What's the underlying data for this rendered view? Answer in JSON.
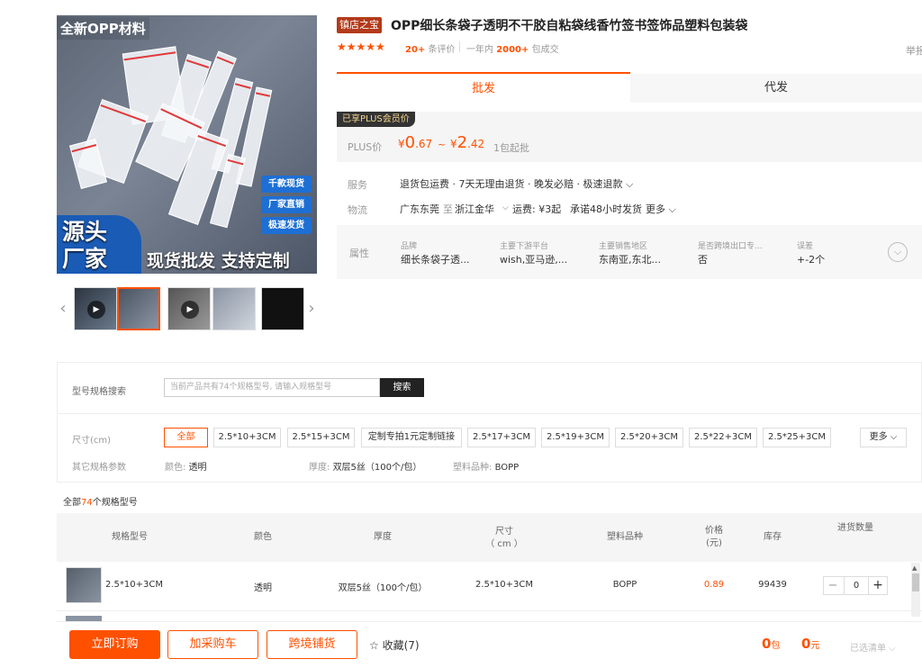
{
  "gallery": {
    "top_tag": "全新OPP材料",
    "pills": [
      "千款现货",
      "厂家直销",
      "极速发货"
    ],
    "source_text": "源头\n厂家",
    "slogan": "现货批发 支持定制",
    "prev_icon": "chevron-left-icon",
    "next_icon": "chevron-right-icon"
  },
  "product": {
    "shop_badge": "镇店之宝",
    "title": "OPP细长条袋子透明不干胶自粘袋线香竹签书签饰品塑料包装袋",
    "report": "举报",
    "rating_stars": 5,
    "reviews_count": "20+",
    "reviews_label": "条评价",
    "year_label": "一年内",
    "year_count": "2000+",
    "year_suffix": "包成交"
  },
  "tabs": {
    "wholesale": "批发",
    "dropship": "代发"
  },
  "price": {
    "plus_tag": "已享PLUS会员价",
    "plus_label": "PLUS价",
    "currency": "¥",
    "low_int": "0",
    "low_dec": ".67",
    "tilde": "~",
    "high_int": "2",
    "high_dec": ".42",
    "moq": "1包起批"
  },
  "service": {
    "label": "服务",
    "value": "退货包运费 · 7天无理由退货 · 晚发必赔 · 极速退款 ⌵"
  },
  "logistics": {
    "label": "物流",
    "from": "广东东莞",
    "to_word": "至",
    "to": "浙江金华",
    "freight": "运费: ¥3起",
    "promise": "承诺48小时发货",
    "more": "更多 ⌵"
  },
  "attributes": {
    "label": "属性",
    "items": [
      {
        "k": "品牌",
        "v": "细长条袋子透..."
      },
      {
        "k": "主要下游平台",
        "v": "wish,亚马逊,..."
      },
      {
        "k": "主要销售地区",
        "v": "东南亚,东北..."
      },
      {
        "k": "是否跨境出口专...",
        "v": "否"
      },
      {
        "k": "误差",
        "v": "+-2个"
      }
    ],
    "toggle_icon": "chevron-down-circle-icon"
  },
  "spec_search": {
    "label": "型号规格搜索",
    "placeholder": "当前产品共有74个规格型号, 请输入规格型号",
    "button": "搜索"
  },
  "sizes": {
    "label": "尺寸(cm)",
    "options": [
      "全部",
      "2.5*10+3CM",
      "2.5*15+3CM",
      "定制专拍1元定制链接",
      "2.5*17+3CM",
      "2.5*19+3CM",
      "2.5*20+3CM",
      "2.5*22+3CM",
      "2.5*25+3CM"
    ],
    "selected": "全部",
    "more": "更多 ⌵"
  },
  "other_params": {
    "label": "其它规格参数",
    "color": {
      "k": "颜色:",
      "v": "透明"
    },
    "thickness": {
      "k": "厚度:",
      "v": "双层5丝（100个/包）"
    },
    "material": {
      "k": "塑料品种:",
      "v": "BOPP"
    }
  },
  "table": {
    "all_prefix": "全部",
    "all_count": "74",
    "all_suffix": "个规格型号",
    "headers": [
      "规格型号",
      "颜色",
      "厚度",
      "尺寸\n（ cm ）",
      "塑料品种",
      "价格\n(元)",
      "库存",
      "进货数量"
    ],
    "rows": [
      {
        "model": "2.5*10+3CM",
        "color": "透明",
        "thickness": "双层5丝（100个/包）",
        "size": "2.5*10+3CM",
        "material": "BOPP",
        "price": "0.89",
        "stock": "99439",
        "qty": "0"
      }
    ]
  },
  "bottom": {
    "buy_now": "立即订购",
    "add_cart": "加采购车",
    "cross_border": "跨境铺货",
    "favorite": "☆ 收藏(7)",
    "total_packs": "0",
    "packs_unit": "包",
    "total_yuan": "0",
    "yuan_unit": "元",
    "selected_list": "已选清单 ⌵"
  },
  "colors": {
    "accent": "#ff5000",
    "dark": "#222222"
  }
}
